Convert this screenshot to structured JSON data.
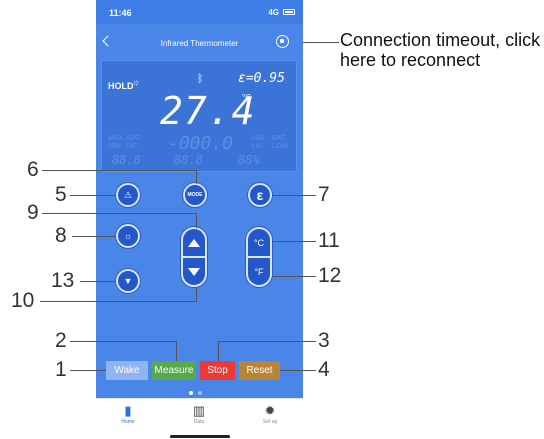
{
  "status_bar": {
    "time": "11:46",
    "network": "4G"
  },
  "nav": {
    "title": "Infrared Thermometer"
  },
  "lcd": {
    "hold": "HOLD",
    "emissivity": "ε=0.95",
    "temperature": "27.4",
    "unit": "°C",
    "secondary_value": "-000.0",
    "ghost_labels": [
      "MAX",
      "AVG",
      "MIN",
      "DIF",
      "HAL",
      "LAL",
      "LOW",
      "BAT"
    ],
    "seg_left": "88.8",
    "seg_mid": "88.8",
    "seg_right": "88%"
  },
  "buttons": {
    "mode_label": "MODE",
    "emissivity_icon": "ε",
    "celsius_label": "°C",
    "fahrenheit_label": "°F"
  },
  "commands": {
    "wake": "Wake",
    "measure": "Measure",
    "stop": "Stop",
    "reset": "Reset"
  },
  "tabs": [
    {
      "label": "Home",
      "icon": "thermometer-icon"
    },
    {
      "label": "Data",
      "icon": "bar-chart-icon"
    },
    {
      "label": "Set up",
      "icon": "gear-icon"
    }
  ],
  "annotation_note": "Connection timeout, click here to reconnect",
  "callouts": [
    "1",
    "2",
    "3",
    "4",
    "5",
    "6",
    "7",
    "8",
    "9",
    "10",
    "11",
    "12",
    "13"
  ],
  "colors": {
    "background": "#4a86e8",
    "wake": "#8fb4f2",
    "measure": "#5aa84c",
    "stop": "#ea3a37",
    "reset": "#b98535"
  }
}
